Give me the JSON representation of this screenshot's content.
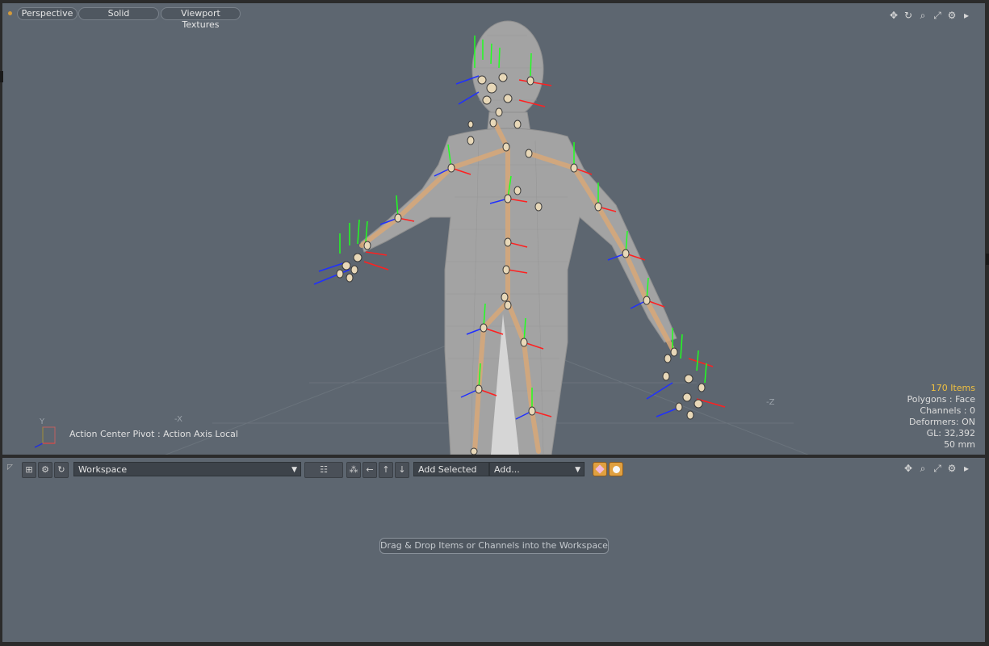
{
  "viewport": {
    "toolbar": {
      "view_mode": "Perspective",
      "shading": "Solid",
      "textures": "Viewport Textures"
    },
    "icons": [
      "move-view-icon",
      "rotate-view-icon",
      "zoom-view-icon",
      "maximize-icon",
      "settings-icon",
      "more-icon"
    ],
    "action_center": "Action Center Pivot : Action Axis Local",
    "axis_labels": {
      "x": "-X",
      "z": "-Z",
      "gizmo_y": "Y"
    },
    "stats": {
      "items": "170 Items",
      "polygons": "Polygons : Face",
      "channels": "Channels : 0",
      "deformers": "Deformers: ON",
      "gl": "GL: 32,392",
      "lens": "50 mm"
    }
  },
  "workspace": {
    "dropdown_value": "Workspace",
    "add_selected": "Add Selected",
    "add_dropdown": "Add...",
    "drop_hint": "Drag & Drop Items or Channels into the Workspace"
  },
  "colors": {
    "panel": "#5d6670",
    "accent": "#e0a040",
    "bone": "#d9a878",
    "x_axis": "#ff2020",
    "y_axis": "#20ff20",
    "z_axis": "#2030ff"
  }
}
